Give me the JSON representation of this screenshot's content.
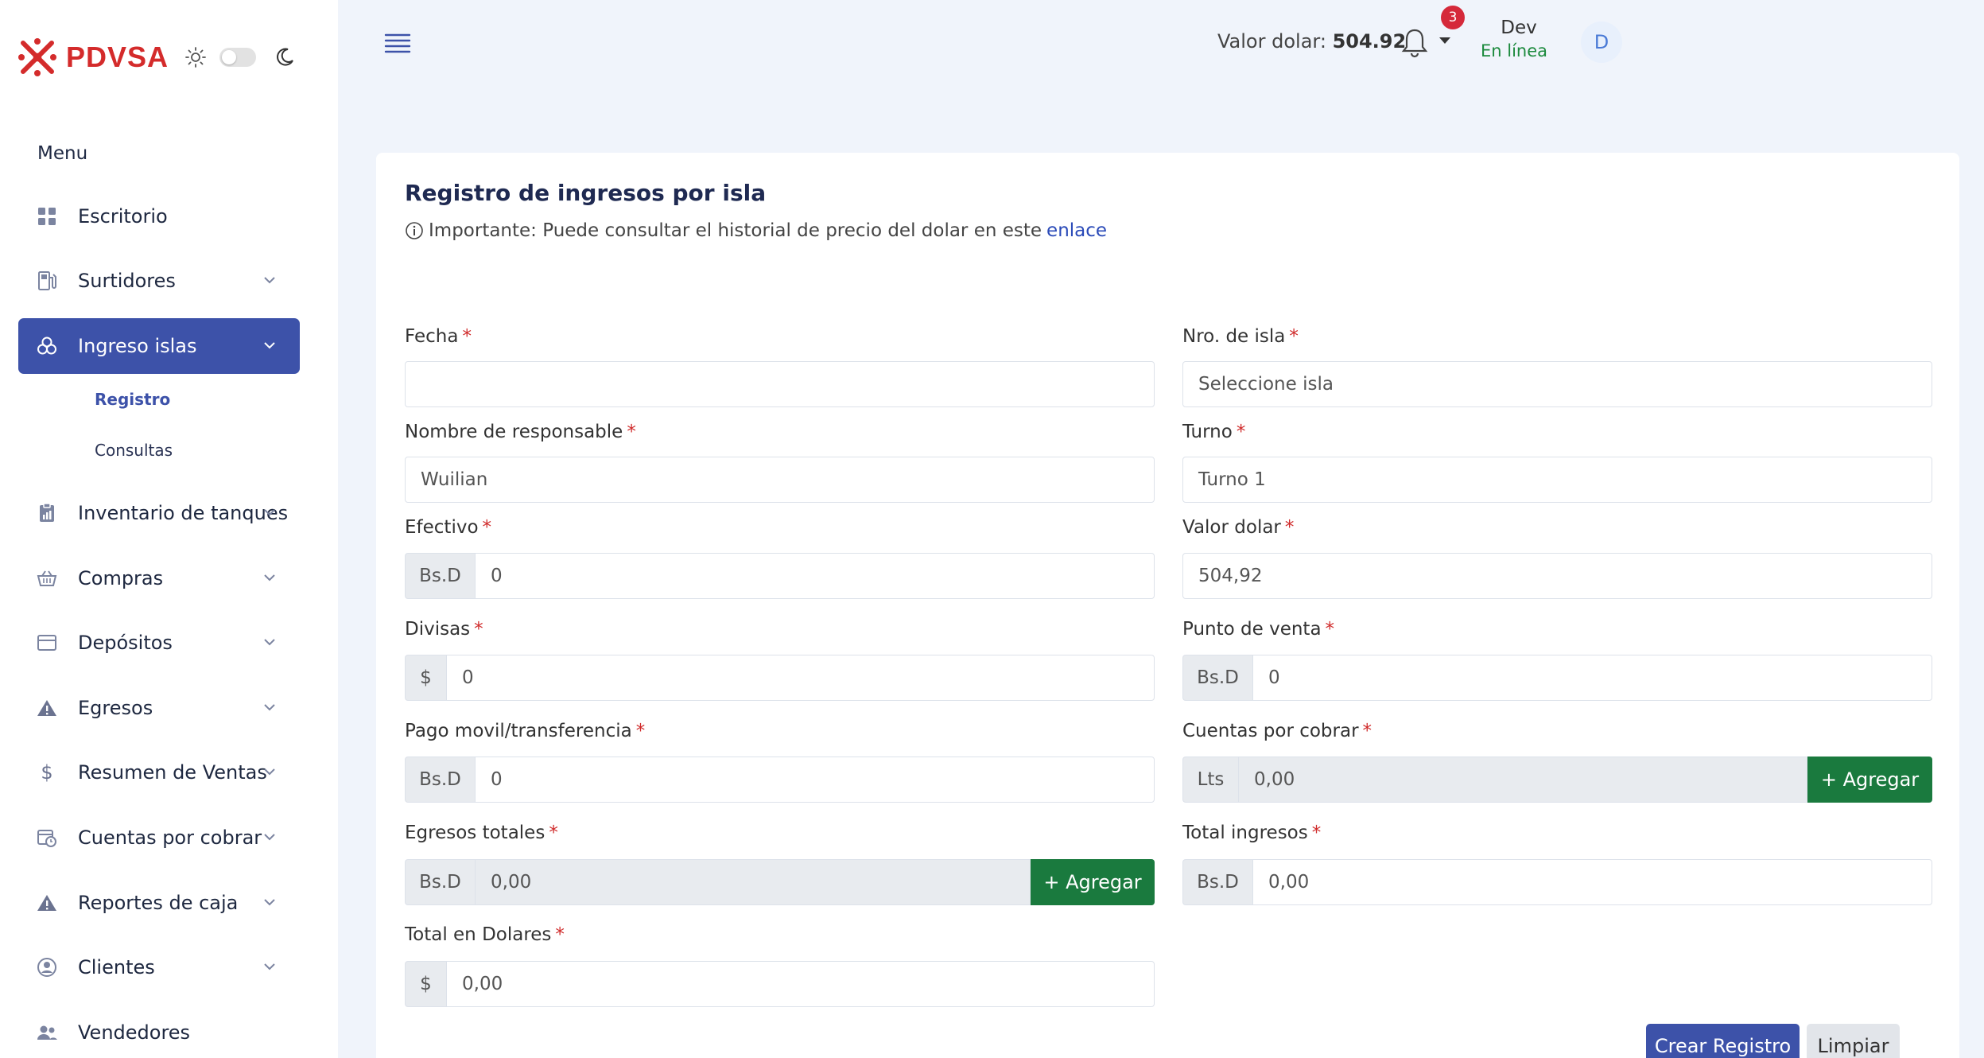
{
  "brand": {
    "name": "PDVSA"
  },
  "topbar": {
    "dollar_label": "Valor dolar:",
    "dollar_value": "504.92",
    "notification_count": "3",
    "user_name": "Dev",
    "user_status": "En línea",
    "avatar_initial": "D"
  },
  "sidebar": {
    "menu_label": "Menu",
    "items": [
      {
        "label": "Escritorio",
        "icon": "grid-icon"
      },
      {
        "label": "Surtidores",
        "icon": "fuel-pump-icon"
      },
      {
        "label": "Ingreso islas",
        "icon": "circles-icon",
        "active": true
      },
      {
        "label": "Inventario de tanques",
        "icon": "clipboard-icon"
      },
      {
        "label": "Compras",
        "icon": "basket-icon"
      },
      {
        "label": "Depósitos",
        "icon": "card-icon"
      },
      {
        "label": "Egresos",
        "icon": "warning-icon"
      },
      {
        "label": "Resumen de Ventas",
        "icon": "dollar-icon"
      },
      {
        "label": "Cuentas por cobrar",
        "icon": "calendar-clock-icon"
      },
      {
        "label": "Reportes de caja",
        "icon": "warning-icon"
      },
      {
        "label": "Clientes",
        "icon": "user-circle-icon"
      },
      {
        "label": "Vendedores",
        "icon": "users-icon"
      }
    ],
    "subitems": [
      {
        "label": "Registro",
        "active": true
      },
      {
        "label": "Consultas"
      }
    ]
  },
  "form": {
    "title": "Registro de ingresos por isla",
    "note": "Importante: Puede consultar el historial de precio del dolar en este",
    "note_link": "enlace",
    "fecha": {
      "label": "Fecha",
      "value": ""
    },
    "nro_isla": {
      "label": "Nro. de isla",
      "value": "Seleccione isla"
    },
    "responsable": {
      "label": "Nombre de responsable",
      "value": "Wuilian"
    },
    "turno": {
      "label": "Turno",
      "value": "Turno 1"
    },
    "efectivo": {
      "label": "Efectivo",
      "addon": "Bs.D",
      "value": "0"
    },
    "valor_dolar": {
      "label": "Valor dolar",
      "value": "504,92"
    },
    "divisas": {
      "label": "Divisas",
      "addon": "$",
      "value": "0"
    },
    "punto_venta": {
      "label": "Punto de venta",
      "addon": "Bs.D",
      "value": "0"
    },
    "pago_movil": {
      "label": "Pago movil/transferencia",
      "addon": "Bs.D",
      "value": "0"
    },
    "cuentas_cobrar": {
      "label": "Cuentas por cobrar",
      "addon": "Lts",
      "value": "0,00",
      "button": "+ Agregar"
    },
    "egresos_totales": {
      "label": "Egresos totales",
      "addon": "Bs.D",
      "value": "0,00",
      "button": "+ Agregar"
    },
    "total_ingresos": {
      "label": "Total ingresos",
      "addon": "Bs.D",
      "value": "0,00"
    },
    "total_dolares": {
      "label": "Total en Dolares",
      "addon": "$",
      "value": "0,00"
    },
    "required_mark": "*",
    "submit": "Crear Registro",
    "clear": "Limpiar"
  },
  "colors": {
    "primary": "#3d52a9",
    "success": "#1a7a3e",
    "danger": "#d5293a",
    "brand_red": "#d42b2b"
  }
}
